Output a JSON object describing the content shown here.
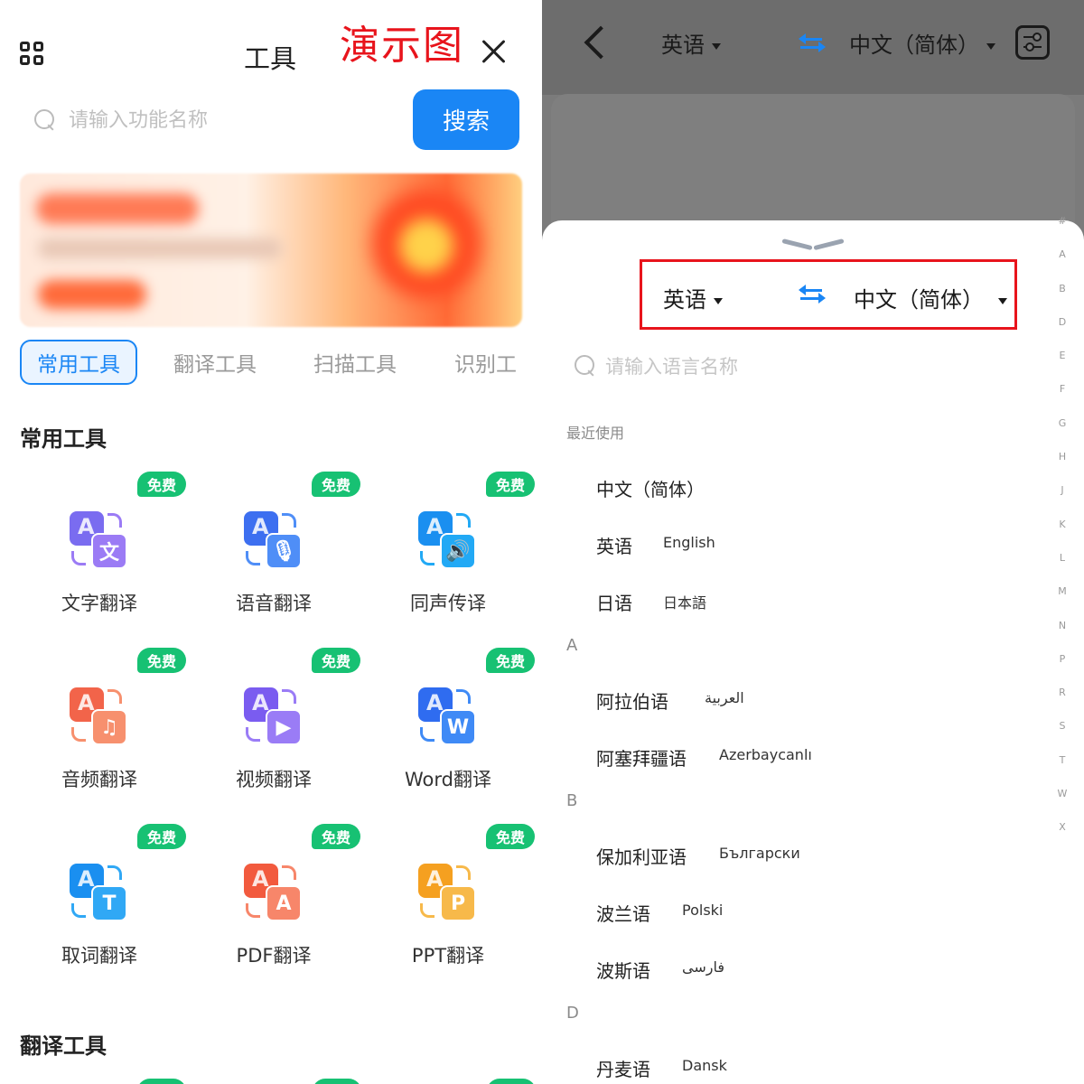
{
  "left": {
    "header": {
      "title": "工具",
      "demo_label": "演示图"
    },
    "search": {
      "placeholder": "请输入功能名称",
      "button": "搜索"
    },
    "tabs": [
      "常用工具",
      "翻译工具",
      "扫描工具",
      "识别工"
    ],
    "section_common": "常用工具",
    "section_translate": "翻译工具",
    "free_badge": "免费",
    "tools": [
      {
        "label": "文字翻译",
        "icon": "text-translate-icon",
        "glyph": "文",
        "color_back": "#7a6cf0",
        "color_front": "#9b7bf5"
      },
      {
        "label": "语音翻译",
        "icon": "voice-translate-icon",
        "glyph": "🎙",
        "color_back": "#3d6ff0",
        "color_front": "#4f8ef7"
      },
      {
        "label": "同声传译",
        "icon": "simultaneous-interpretation-icon",
        "glyph": "🔊",
        "color_back": "#1a8ff0",
        "color_front": "#22a9f5"
      },
      {
        "label": "音频翻译",
        "icon": "audio-translate-icon",
        "glyph": "♫",
        "color_back": "#f2644a",
        "color_front": "#f7906e"
      },
      {
        "label": "视频翻译",
        "icon": "video-translate-icon",
        "glyph": "▶",
        "color_back": "#7a5cf0",
        "color_front": "#9a7cf6"
      },
      {
        "label": "Word翻译",
        "icon": "word-translate-icon",
        "glyph": "W",
        "color_back": "#2f6cf0",
        "color_front": "#3f8af6"
      },
      {
        "label": "取词翻译",
        "icon": "word-pick-translate-icon",
        "glyph": "T",
        "color_back": "#1a8ff0",
        "color_front": "#30a8f5"
      },
      {
        "label": "PDF翻译",
        "icon": "pdf-translate-icon",
        "glyph": "A",
        "color_back": "#f25a3e",
        "color_front": "#f7866a"
      },
      {
        "label": "PPT翻译",
        "icon": "ppt-translate-icon",
        "glyph": "P",
        "color_back": "#f5a020",
        "color_front": "#f7b94a"
      }
    ]
  },
  "right": {
    "topbar": {
      "source_lang": "英语",
      "target_lang": "中文（简体）"
    },
    "sheet": {
      "source_lang": "英语",
      "target_lang": "中文（简体）",
      "search_placeholder": "请输入语言名称",
      "recent_header": "最近使用",
      "recent": [
        {
          "cn": "中文（简体）",
          "native": ""
        },
        {
          "cn": "英语",
          "native": "English"
        },
        {
          "cn": "日语",
          "native": "日本語"
        }
      ],
      "groups": [
        {
          "letter": "A",
          "items": [
            {
              "cn": "阿拉伯语",
              "native": "العربية"
            },
            {
              "cn": "阿塞拜疆语",
              "native": "Azerbaycanlı"
            }
          ]
        },
        {
          "letter": "B",
          "items": [
            {
              "cn": "保加利亚语",
              "native": "Български"
            },
            {
              "cn": "波兰语",
              "native": "Polski"
            },
            {
              "cn": "波斯语",
              "native": "فارسی"
            }
          ]
        },
        {
          "letter": "D",
          "items": [
            {
              "cn": "丹麦语",
              "native": "Dansk"
            }
          ]
        }
      ],
      "index_letters": [
        "#",
        "A",
        "B",
        "D",
        "E",
        "F",
        "G",
        "H",
        "J",
        "K",
        "L",
        "M",
        "N",
        "P",
        "R",
        "S",
        "T",
        "W",
        "X"
      ]
    }
  },
  "colors": {
    "accent": "#1a86f5",
    "free_badge": "#17c173",
    "demo_red": "#e8141c",
    "highlight_box": "#e8141c"
  }
}
